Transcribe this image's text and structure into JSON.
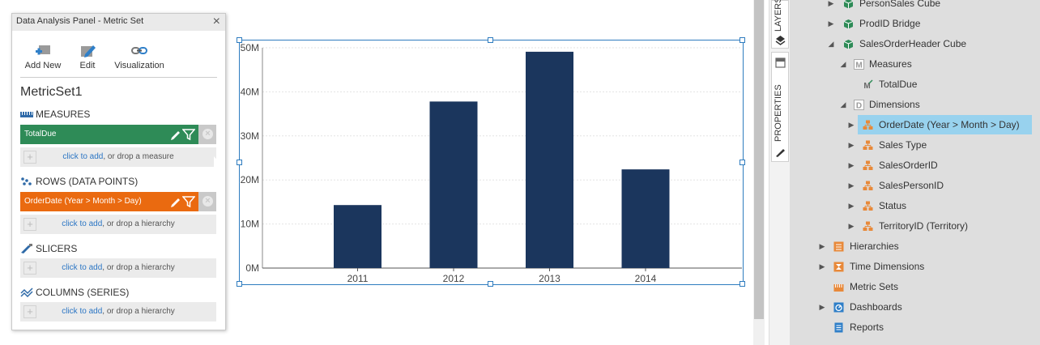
{
  "panel": {
    "title": "Data Analysis Panel - Metric Set",
    "close_glyph": "×",
    "toolbar": {
      "add_new": "Add New",
      "edit": "Edit",
      "visualization": "Visualization"
    },
    "metricset_name": "MetricSet1",
    "sections": {
      "measures": "MEASURES",
      "rows": "ROWS (DATA POINTS)",
      "slicers": "SLICERS",
      "columns": "COLUMNS (SERIES)"
    },
    "measure_item": "TotalDue",
    "row_item": "OrderDate (Year > Month > Day)",
    "dropzones": {
      "link": "click to add",
      "measure_rest": ", or drop a measure",
      "hierarchy_rest": ", or drop a hierarchy"
    },
    "colors": {
      "measure": "#2e8b57",
      "row": "#ea6a10",
      "link": "#2c76c4"
    }
  },
  "chart_data": {
    "type": "bar",
    "categories": [
      "2011",
      "2012",
      "2013",
      "2014"
    ],
    "values": [
      14.3,
      37.8,
      49.1,
      22.4
    ],
    "unit_suffix": "M",
    "yticks": [
      "0M",
      "10M",
      "20M",
      "30M",
      "40M",
      "50M"
    ],
    "ylim": [
      0,
      50
    ],
    "bar_color": "#1b365d",
    "grid": true
  },
  "side_tabs": {
    "layers": "LAYERS",
    "properties": "PROPERTIES"
  },
  "tree": {
    "nodes": [
      {
        "label": "PersonSales Cube",
        "icon": "cube-icon",
        "arrow": "collapsed"
      },
      {
        "label": "ProdID Bridge",
        "icon": "cube-icon",
        "arrow": "collapsed"
      },
      {
        "label": "SalesOrderHeader Cube",
        "icon": "cube-icon",
        "arrow": "expanded"
      },
      {
        "label": "Measures",
        "icon": "measures-folder-icon",
        "arrow": "expanded"
      },
      {
        "label": "TotalDue",
        "icon": "measure-icon",
        "arrow": "none"
      },
      {
        "label": "Dimensions",
        "icon": "dimensions-folder-icon",
        "arrow": "expanded"
      },
      {
        "label": "OrderDate (Year > Month > Day)",
        "icon": "hierarchy-icon",
        "arrow": "collapsed",
        "selected": true
      },
      {
        "label": "Sales Type",
        "icon": "hierarchy-icon",
        "arrow": "collapsed"
      },
      {
        "label": "SalesOrderID",
        "icon": "hierarchy-icon",
        "arrow": "collapsed"
      },
      {
        "label": "SalesPersonID",
        "icon": "hierarchy-icon",
        "arrow": "collapsed"
      },
      {
        "label": "Status",
        "icon": "hierarchy-icon",
        "arrow": "collapsed"
      },
      {
        "label": "TerritoryID (Territory)",
        "icon": "hierarchy-icon",
        "arrow": "collapsed"
      },
      {
        "label": "Hierarchies",
        "icon": "hierarchies-icon",
        "arrow": "collapsed"
      },
      {
        "label": "Time Dimensions",
        "icon": "time-dimensions-icon",
        "arrow": "collapsed"
      },
      {
        "label": "Metric Sets",
        "icon": "metric-sets-icon",
        "arrow": "none"
      },
      {
        "label": "Dashboards",
        "icon": "dashboards-icon",
        "arrow": "collapsed"
      },
      {
        "label": "Reports",
        "icon": "reports-icon",
        "arrow": "none"
      }
    ],
    "colors": {
      "selected": "#98d2ee",
      "cube": "#2e8b57",
      "hierarchy": "#e8893a"
    }
  }
}
